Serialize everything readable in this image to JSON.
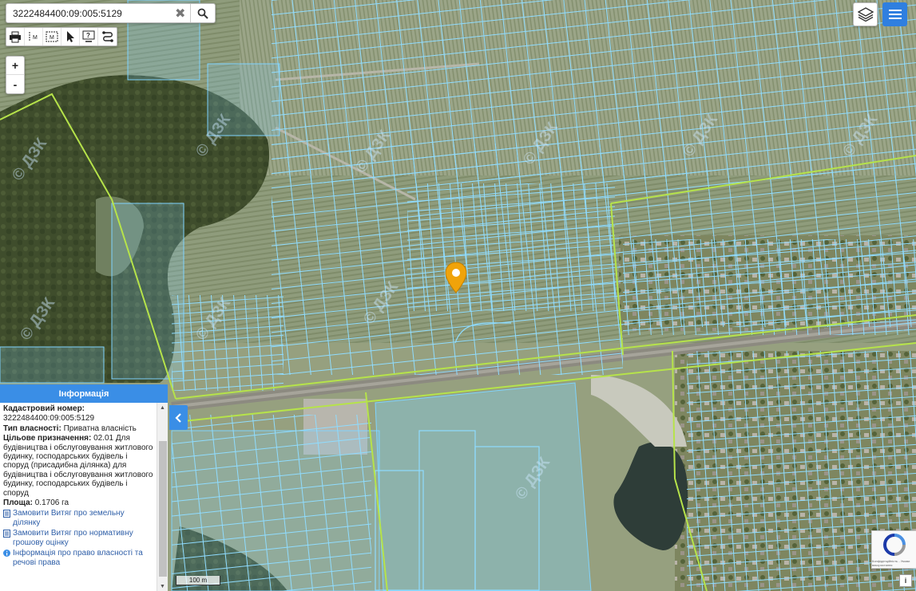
{
  "search": {
    "value": "3222484400:09:005:5129",
    "placeholder": ""
  },
  "toolbar": {
    "tools": [
      "print-icon",
      "measure-line-icon",
      "measure-area-icon",
      "pointer-icon",
      "identify-icon",
      "route-icon"
    ]
  },
  "zoom": {
    "in": "+",
    "out": "-"
  },
  "watermarks": [
    "© ДЗК",
    "© ДЗК",
    "© ДЗК",
    "© ДЗК",
    "© ДЗК",
    "© ДЗК",
    "© ДЗК",
    "© ДЗК",
    "© ДЗК",
    "© ДЗК"
  ],
  "info_panel": {
    "title": "Інформація",
    "cadastral_label": "Кадастровий номер:",
    "cadastral_value": "3222484400:09:005:5129",
    "ownership_label": "Тип власності:",
    "ownership_value": "Приватна власність",
    "purpose_label": "Цільове призначення:",
    "purpose_value": "02.01 Для будівництва і обслуговування житлового будинку, господарських будівель і споруд (присадибна ділянка) для будівництва і обслуговування житлового будинку, господарських будівель і споруд",
    "area_label": "Площа:",
    "area_value": "0.1706 га",
    "link1": "Замовити Витяг про земельну ділянку",
    "link2": "Замовити Витяг про нормативну грошову оцінку",
    "link3": "Інформація про право власності та речові права"
  },
  "scale": "100 m",
  "recaptcha_text": "Конфіденційність - Умови використання",
  "info_button": "i",
  "colors": {
    "parcel": "#7fd3ff",
    "boundary": "#b6e34a",
    "marker": "#f0a30a",
    "accent": "#3a8ee6"
  }
}
